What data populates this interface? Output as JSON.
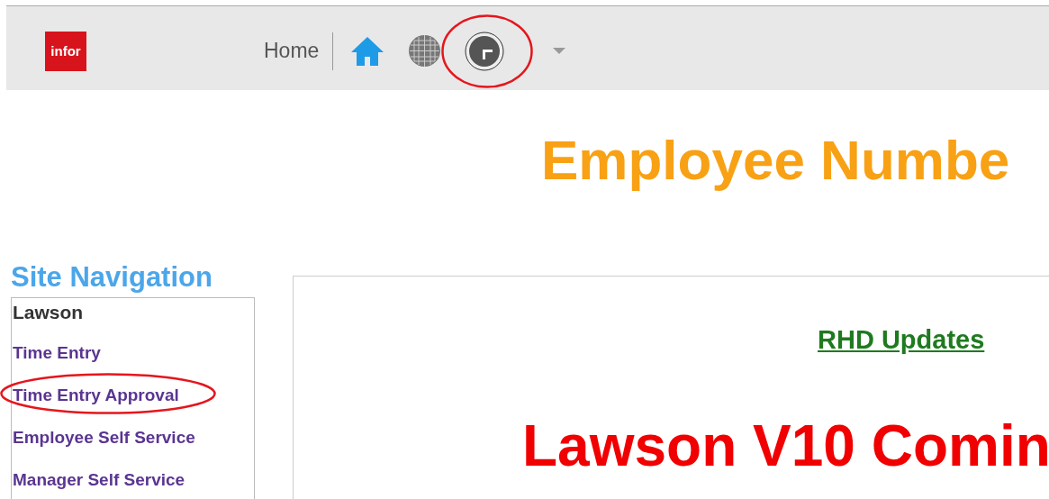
{
  "header": {
    "logo": "infor",
    "home_label": "Home",
    "icons": [
      {
        "kind": "home",
        "circled": false
      },
      {
        "kind": "globe",
        "circled": false
      },
      {
        "kind": "clock",
        "circled": true
      }
    ]
  },
  "page_title": "Employee Numbe",
  "site_navigation": {
    "title": "Site Navigation",
    "group": "Lawson",
    "items": [
      {
        "label": "Time Entry",
        "circled": false
      },
      {
        "label": "Time Entry Approval",
        "circled": true
      },
      {
        "label": "Employee Self Service",
        "circled": false
      },
      {
        "label": "Manager Self Service",
        "circled": false
      }
    ]
  },
  "content": {
    "link": "RHD Updates",
    "headline": "Lawson V10 Comin"
  }
}
